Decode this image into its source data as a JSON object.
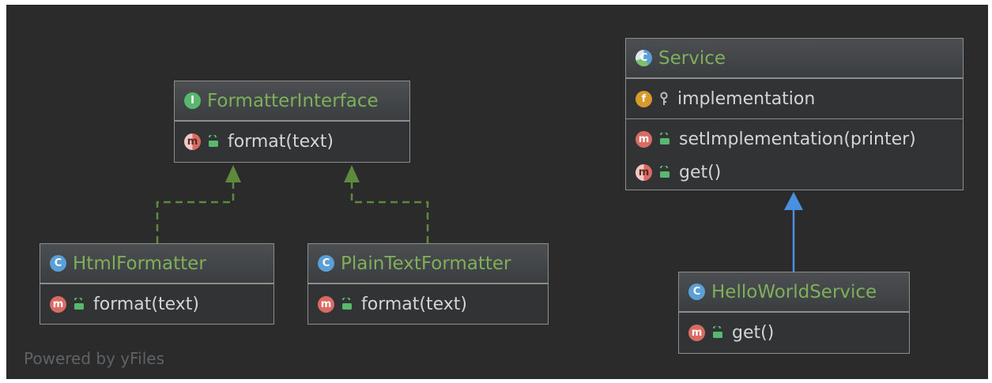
{
  "colors": {
    "background": "#2b2b2b",
    "node_fill": "#313335",
    "node_border": "#8d8d8d",
    "title_text": "#7eb05a",
    "member_text": "#d4d4d4",
    "realization_edge": "#5d8a3c",
    "inheritance_edge": "#4a8fe0"
  },
  "nodes": {
    "formatter_interface": {
      "kind_badge": "I",
      "title": "FormatterInterface",
      "methods": [
        {
          "badge": "m",
          "visibility_icon": "lock-open-icon",
          "abstract": true,
          "text": "format(text)"
        }
      ]
    },
    "html_formatter": {
      "kind_badge": "C",
      "title": "HtmlFormatter",
      "methods": [
        {
          "badge": "m",
          "visibility_icon": "lock-open-icon",
          "text": "format(text)"
        }
      ]
    },
    "plain_text_formatter": {
      "kind_badge": "C",
      "title": "PlainTextFormatter",
      "methods": [
        {
          "badge": "m",
          "visibility_icon": "lock-open-icon",
          "text": "format(text)"
        }
      ]
    },
    "service": {
      "kind_badge": "C",
      "title": "Service",
      "fields": [
        {
          "badge": "f",
          "visibility_icon": "key-icon",
          "text": "implementation"
        }
      ],
      "methods": [
        {
          "badge": "m",
          "visibility_icon": "lock-open-icon",
          "text": "setImplementation(printer)"
        },
        {
          "badge": "m",
          "visibility_icon": "lock-open-icon",
          "abstract": true,
          "text": "get()"
        }
      ]
    },
    "hello_world_service": {
      "kind_badge": "C",
      "title": "HelloWorldService",
      "methods": [
        {
          "badge": "m",
          "visibility_icon": "lock-open-icon",
          "text": "get()"
        }
      ]
    }
  },
  "edges": [
    {
      "from": "html_formatter",
      "to": "formatter_interface",
      "type": "realization"
    },
    {
      "from": "plain_text_formatter",
      "to": "formatter_interface",
      "type": "realization"
    },
    {
      "from": "hello_world_service",
      "to": "service",
      "type": "inheritance"
    }
  ],
  "footer": {
    "text": "Powered by yFiles"
  }
}
